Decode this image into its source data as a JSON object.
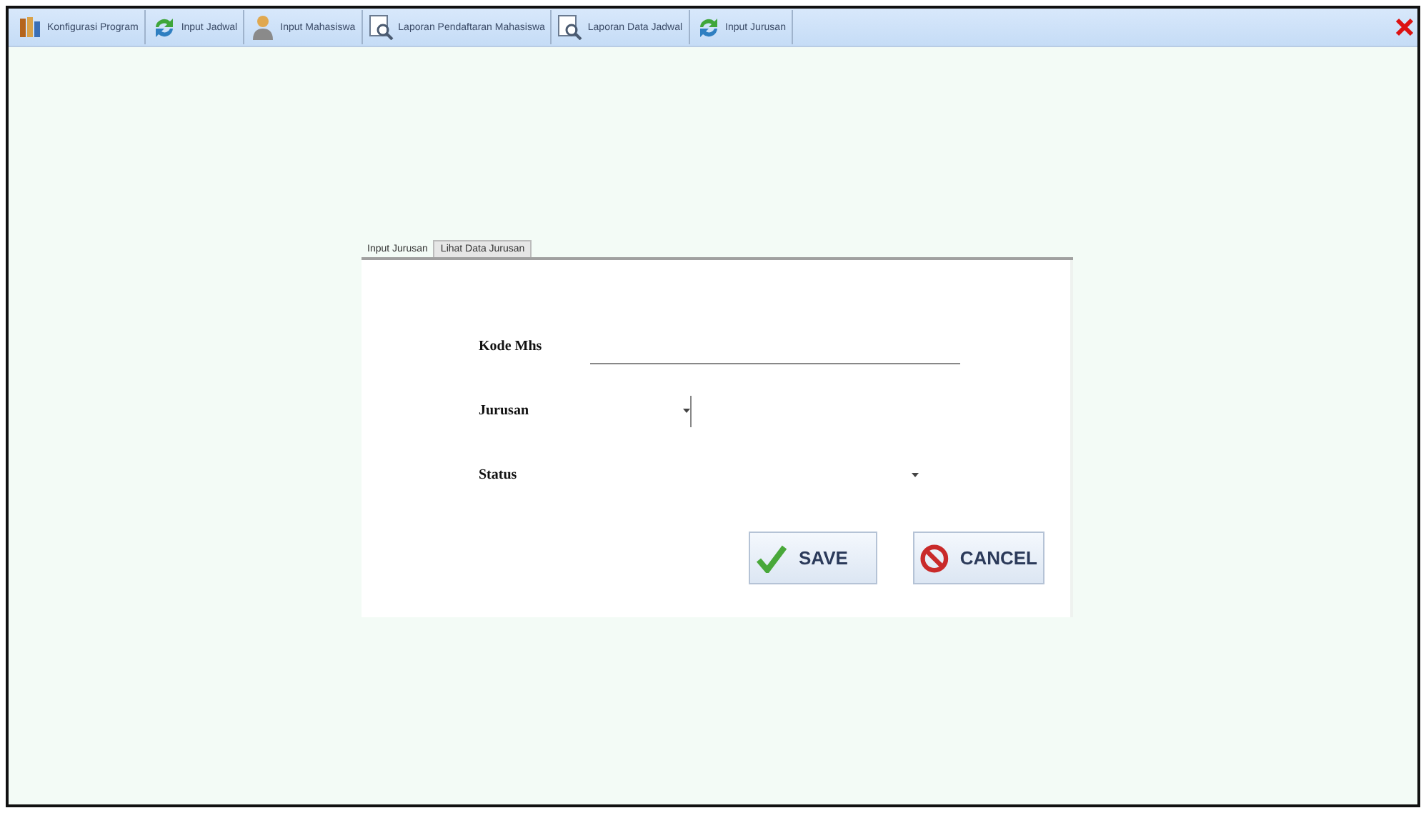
{
  "toolbar": {
    "items": [
      {
        "label": "Konfigurasi Program",
        "kind": "books"
      },
      {
        "label": "Input Jadwal",
        "kind": "refresh"
      },
      {
        "label": "Input Mahasiswa",
        "kind": "person"
      },
      {
        "label": "Laporan Pendaftaran Mahasiswa",
        "kind": "report"
      },
      {
        "label": "Laporan Data Jadwal",
        "kind": "report"
      },
      {
        "label": "Input Jurusan",
        "kind": "refresh"
      }
    ]
  },
  "tabs": [
    {
      "label": "Input Jurusan",
      "selected": true
    },
    {
      "label": "Lihat Data Jurusan",
      "selected": false
    }
  ],
  "form": {
    "fields": [
      {
        "label": "Kode Mhs",
        "kind": "text"
      },
      {
        "label": "Jurusan",
        "kind": "combo"
      },
      {
        "label": "Status",
        "kind": "dropdown"
      }
    ]
  },
  "buttons": [
    {
      "label": "SAVE",
      "kind": "save"
    },
    {
      "label": "CANCEL",
      "kind": "cancel"
    }
  ]
}
